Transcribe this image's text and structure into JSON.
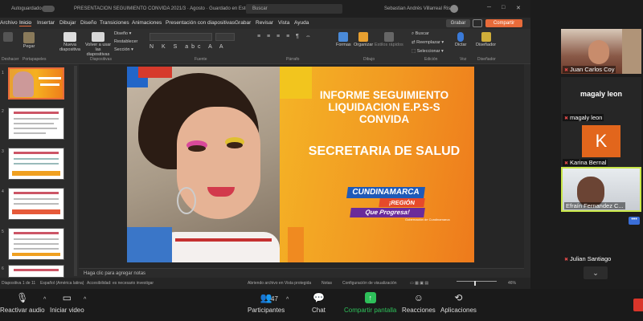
{
  "ppt": {
    "titlebar": {
      "autosave": "Autoguardado",
      "doc_title": "PRESENTACION SEGUIMIENTO CONVIDA 2021/3 · Agosto · Guardado en Este PC",
      "search": "Buscar",
      "user": "Sebastian Andrés Villarreal Riso"
    },
    "menu": [
      "Archivo",
      "Inicio",
      "Insertar",
      "Dibujar",
      "Diseño",
      "Transiciones",
      "Animaciones",
      "Presentación con diapositivas",
      "Grabar",
      "Revisar",
      "Vista",
      "Ayuda"
    ],
    "grabar": "Grabar",
    "compartir": "Compartir",
    "ribbon": {
      "deshacer": "Deshacer",
      "pegar": "Pegar",
      "nueva": "Nueva diapositiva",
      "reusar": "Volver a usar las diapositivas",
      "diseno": "Diseño",
      "restablecer": "Restablecer",
      "seccion": "Sección",
      "formas": "Formas",
      "organizar": "Organizar",
      "estilos": "Estilos rápidos",
      "buscar": "Buscar",
      "reemplazar": "Reemplazar",
      "seleccionar": "Seleccionar",
      "dictar": "Dictar",
      "disenador": "Diseñador",
      "groups": {
        "deshacer": "Deshacer",
        "portapapeles": "Portapapeles",
        "diapositivas": "Diapositivas",
        "fuente": "Fuente",
        "parrafo": "Párrafo",
        "dibujo": "Dibujo",
        "edicion": "Edición",
        "voz": "Voz",
        "disenador": "Diseñador"
      }
    },
    "thumb_numbers": [
      "1",
      "2",
      "3",
      "4",
      "5",
      "6"
    ],
    "slide": {
      "title": "INFORME SEGUIMIENTO LIQUIDACION E.P.S-S CONVIDA",
      "subtitle": "SECRETARIA DE SALUD",
      "logo_main": "CUNDINAMARCA",
      "logo_region": "¡REGIÓN",
      "logo_tagline": "Que Progresa!",
      "logo_gov": "Gobernación de Cundinamarca"
    },
    "notes_placeholder": "Haga clic para agregar notas",
    "status": {
      "slide_pos": "Diapositiva 1 de 11",
      "language": "Español (América latina)",
      "accessibility": "Accesibilidad: es necesario investigar",
      "protected": "Abriendo archivo en Vista protegida",
      "notes": "Notas",
      "display": "Configuración de visualización",
      "zoom": "46%"
    }
  },
  "participants": [
    {
      "name": "Juan Carlos Coy",
      "type": "video"
    },
    {
      "name": "magaly leon",
      "display_name": "magaly leon",
      "type": "name"
    },
    {
      "name": "Karina Bernal",
      "initial": "K",
      "type": "avatar"
    },
    {
      "name": "Efraín Fernandez C...",
      "type": "video",
      "active": true
    },
    {
      "name": "Julian Santiago",
      "type": "none"
    }
  ],
  "zoom_toolbar": {
    "audio": "Reactivar audio",
    "video": "Iniciar video",
    "participants": "Participantes",
    "participants_count": "47",
    "chat": "Chat",
    "share": "Compartir pantalla",
    "reactions": "Reacciones",
    "apps": "Aplicaciones"
  },
  "colors": {
    "accent_orange": "#e86b3a",
    "share_green": "#2ec05a",
    "active_speaker": "#c8e648"
  }
}
